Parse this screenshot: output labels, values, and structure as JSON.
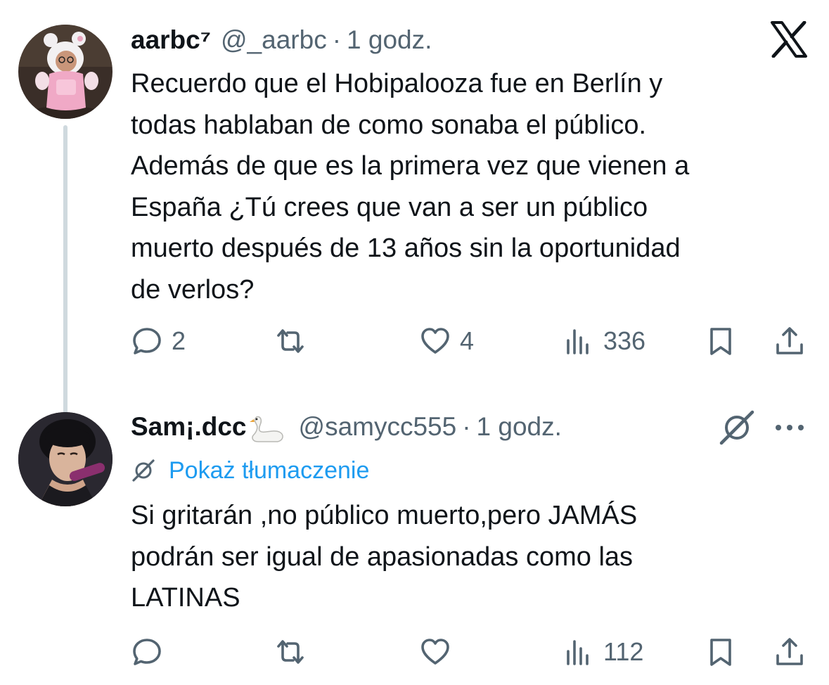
{
  "tweet1": {
    "display_name": "aarbc⁷",
    "handle": "@_aarbc",
    "separator": "·",
    "time": "1 godz.",
    "text": "Recuerdo que el Hobipalooza fue en Berlín y\ntodas hablaban de como sonaba el público.\nAdemás de que es la primera vez que vienen a\nEspaña ¿Tú crees que van a ser un público\nmuerto después de 13 años sin la oportunidad\nde verlos?",
    "replies": "2",
    "likes": "4",
    "views": "336"
  },
  "tweet2": {
    "display_name": "Sam¡.dcc",
    "handle": "@samycc555",
    "separator": "·",
    "time": "1 godz.",
    "translate_label": "Pokaż tłumaczenie",
    "text": "Si gritarán ,no público muerto,pero JAMÁS\npodrán ser igual de apasionadas como las\nLATINAS",
    "views": "112"
  },
  "icons": {
    "brand": "x-logo-icon",
    "reply": "reply-icon",
    "retweet": "retweet-icon",
    "like": "heart-icon",
    "views": "views-chart-icon",
    "bookmark": "bookmark-icon",
    "share": "share-icon",
    "translate": "translate-icon",
    "more": "more-dots-icon",
    "name_emoji": "swan-emoji-icon"
  },
  "colors": {
    "text": "#0f1419",
    "secondary": "#536471",
    "link": "#1d9bf0",
    "thread_line": "#cfd9de"
  }
}
